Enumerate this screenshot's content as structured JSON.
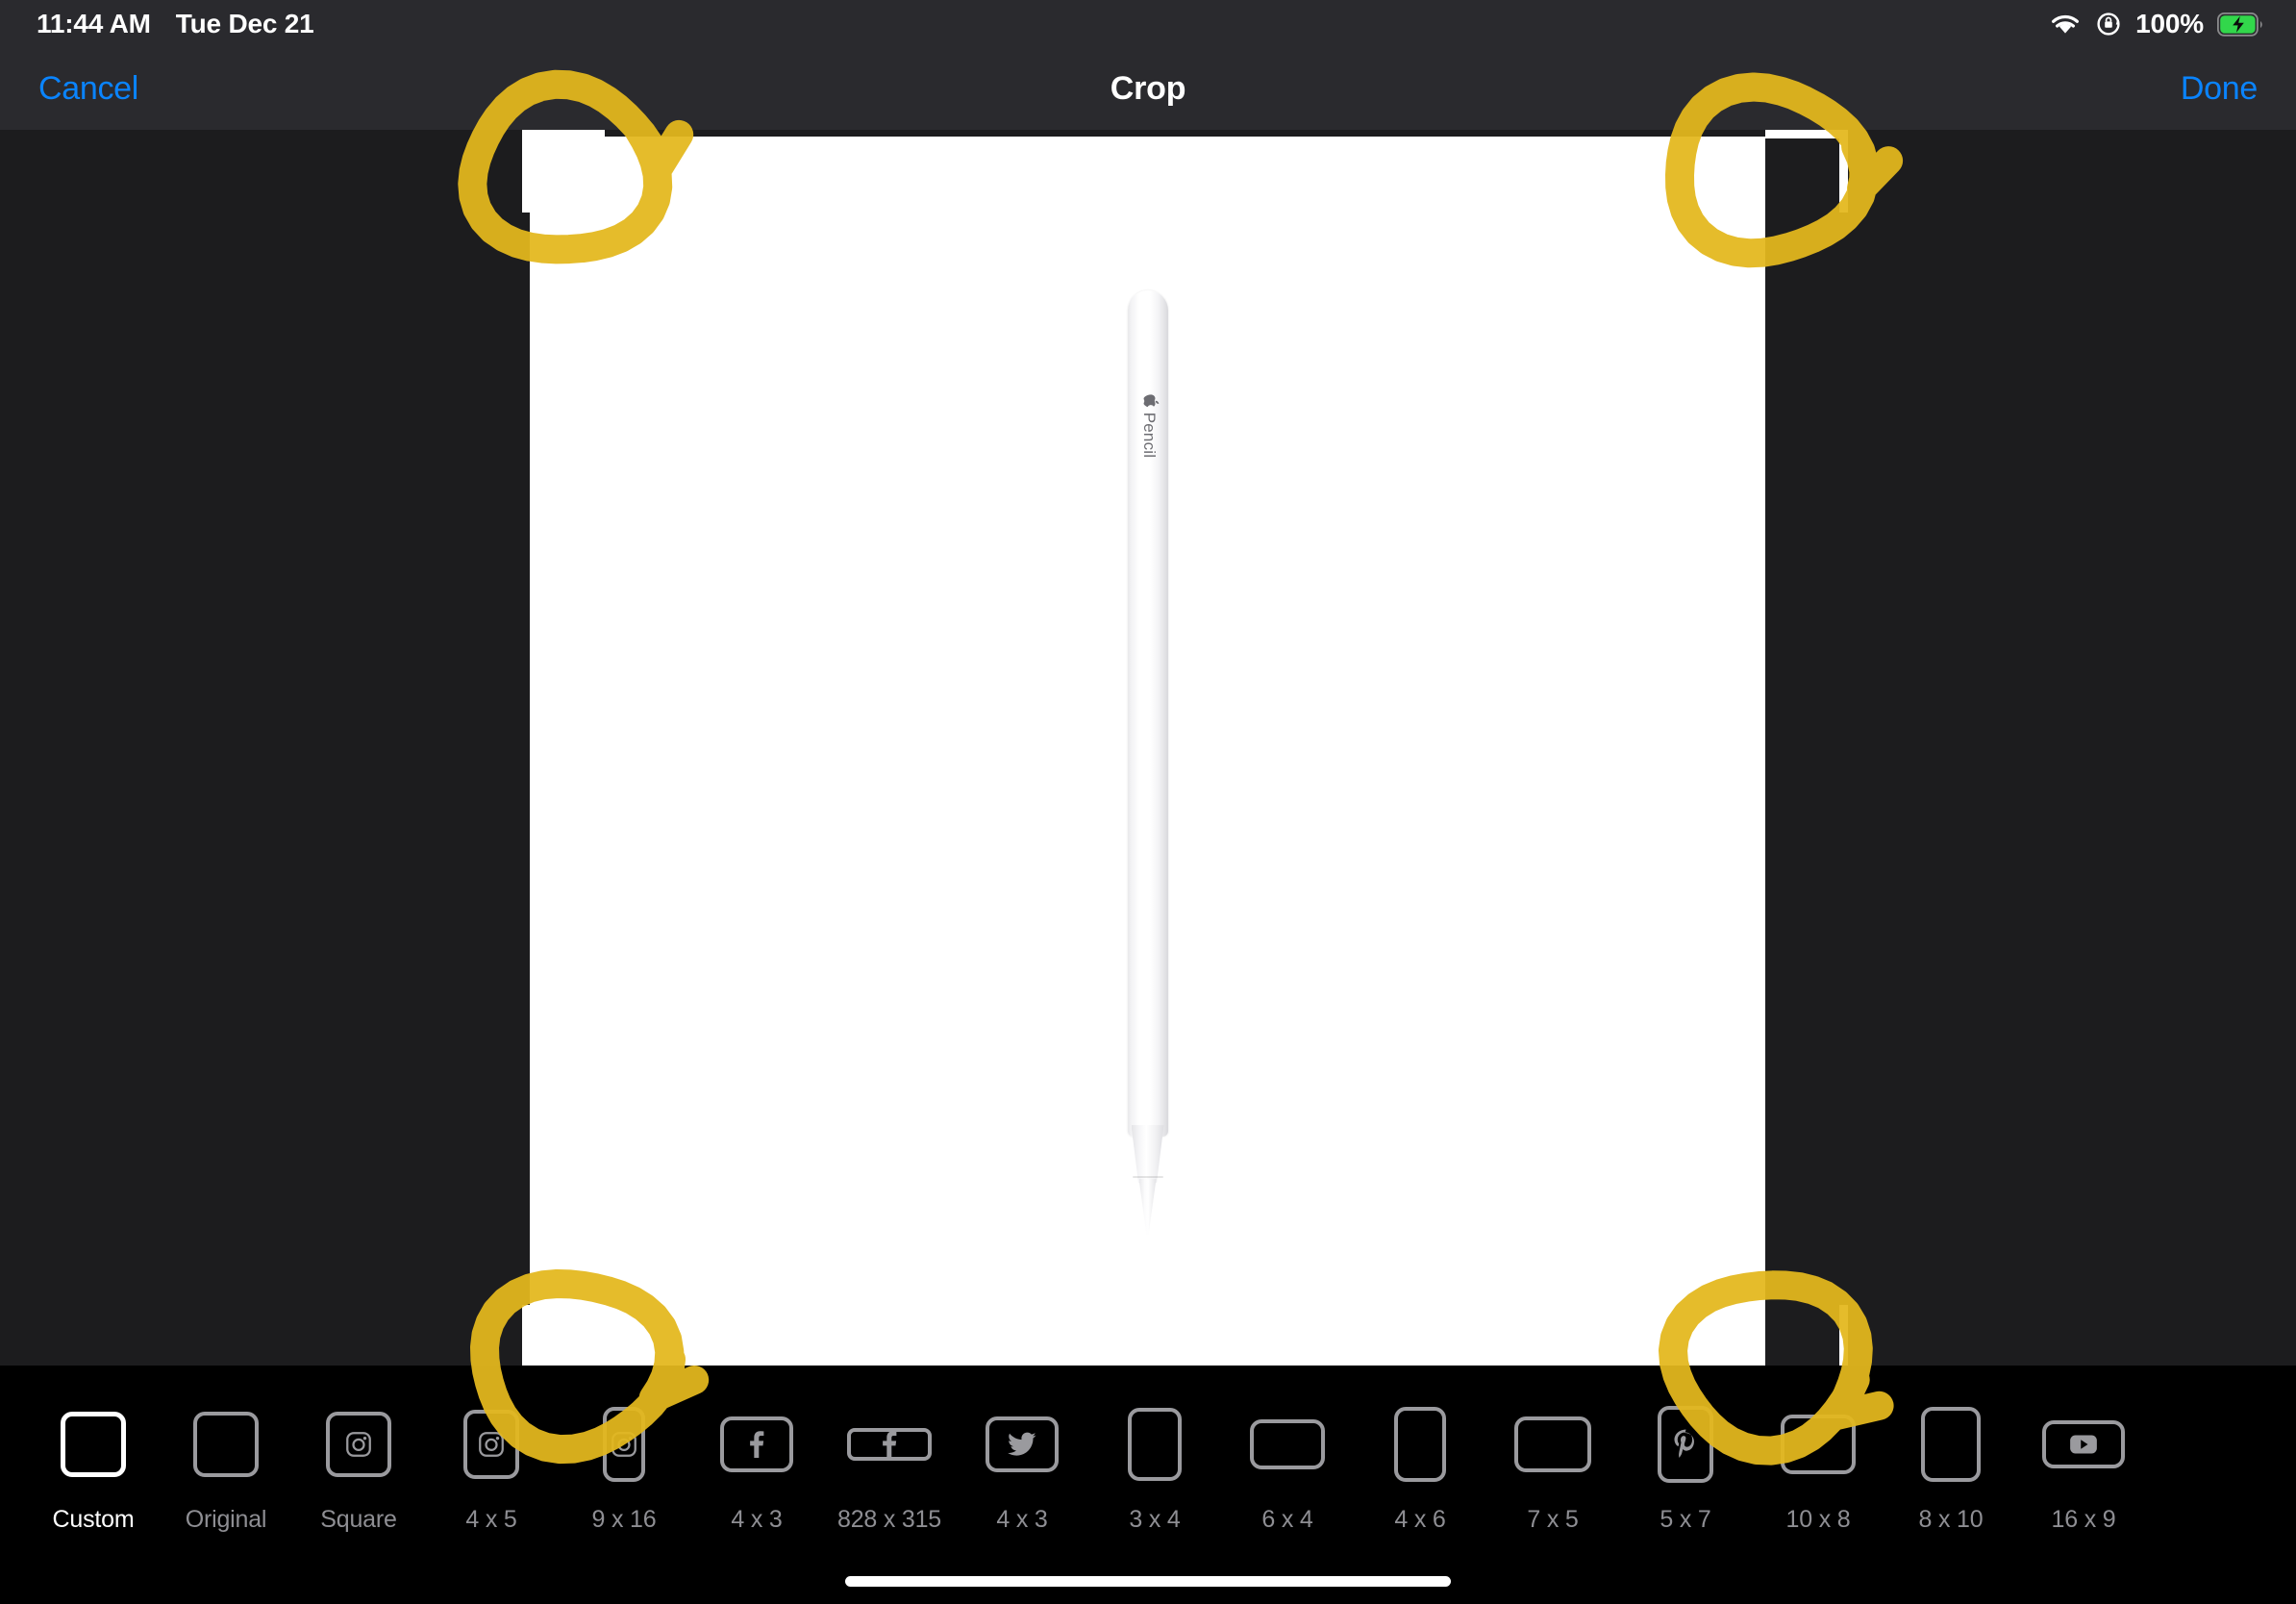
{
  "status_bar": {
    "time": "11:44 AM",
    "date": "Tue Dec 21",
    "battery_percent": "100%",
    "icons": {
      "wifi": "wifi-icon",
      "rotation_lock": "rotation-lock-icon",
      "battery": "battery-charging-icon"
    },
    "battery_color": "#32D74B"
  },
  "nav_bar": {
    "cancel_label": "Cancel",
    "title": "Crop",
    "done_label": "Done",
    "accent_color": "#0A84FF"
  },
  "canvas": {
    "photo_alt": "Apple Pencil on white background",
    "pencil_label": "Pencil",
    "pencil_logo": "apple-logo-icon",
    "crop_handles": [
      "top-left",
      "top-right",
      "bottom-left",
      "bottom-right"
    ]
  },
  "annotations": {
    "color": "#E3B81E",
    "shape": "circle-scribble",
    "count": 4,
    "targets": [
      "top-left-handle",
      "top-right-handle",
      "bottom-left-handle",
      "bottom-right-handle"
    ]
  },
  "toolbar": {
    "ratios": [
      {
        "label": "Custom",
        "icon": "none",
        "w": 68,
        "h": 68,
        "selected": true
      },
      {
        "label": "Original",
        "icon": "none",
        "w": 68,
        "h": 68,
        "selected": false
      },
      {
        "label": "Square",
        "icon": "instagram-icon",
        "w": 68,
        "h": 68,
        "selected": false
      },
      {
        "label": "4 x 5",
        "icon": "instagram-icon",
        "w": 58,
        "h": 72,
        "selected": false
      },
      {
        "label": "9 x 16",
        "icon": "instagram-icon",
        "w": 44,
        "h": 78,
        "selected": false
      },
      {
        "label": "4 x 3",
        "icon": "facebook-icon",
        "w": 76,
        "h": 58,
        "selected": false
      },
      {
        "label": "828 x 315",
        "icon": "facebook-icon",
        "w": 88,
        "h": 34,
        "selected": false
      },
      {
        "label": "4 x 3",
        "icon": "twitter-icon",
        "w": 76,
        "h": 58,
        "selected": false
      },
      {
        "label": "3 x 4",
        "icon": "none",
        "w": 56,
        "h": 76,
        "selected": false
      },
      {
        "label": "6 x 4",
        "icon": "none",
        "w": 78,
        "h": 52,
        "selected": false
      },
      {
        "label": "4 x 6",
        "icon": "none",
        "w": 54,
        "h": 78,
        "selected": false
      },
      {
        "label": "7 x 5",
        "icon": "none",
        "w": 80,
        "h": 58,
        "selected": false
      },
      {
        "label": "5 x 7",
        "icon": "pinterest-icon",
        "w": 58,
        "h": 80,
        "selected": false
      },
      {
        "label": "10 x 8",
        "icon": "none",
        "w": 78,
        "h": 62,
        "selected": false
      },
      {
        "label": "8 x 10",
        "icon": "none",
        "w": 62,
        "h": 78,
        "selected": false
      },
      {
        "label": "16 x 9",
        "icon": "youtube-icon",
        "w": 86,
        "h": 50,
        "selected": false
      }
    ],
    "border_color": "#9A9A9E",
    "selected_border_color": "#FFFFFF",
    "label_color": "#8E8E93"
  },
  "home_indicator": {
    "present": true
  }
}
